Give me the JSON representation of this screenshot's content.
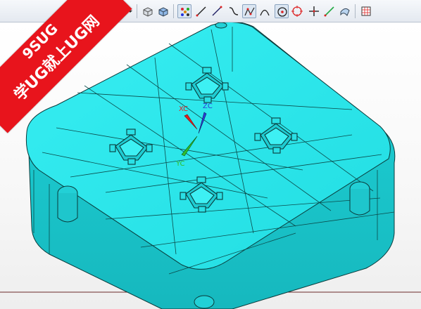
{
  "toolbar": {
    "buttons": [
      {
        "name": "rectangle-select-icon"
      },
      {
        "name": "select-dropdown-icon"
      },
      {
        "name": "shaded-body-icon"
      },
      {
        "name": "solid-block-icon"
      },
      {
        "name": "snap-points-icon"
      },
      {
        "name": "line-curve-icon"
      },
      {
        "name": "arc-curve-icon"
      },
      {
        "name": "spline-icon"
      },
      {
        "name": "studio-spline-icon"
      },
      {
        "name": "conic-curve-icon"
      },
      {
        "name": "arc-center-icon"
      },
      {
        "name": "circle-icon"
      },
      {
        "name": "point-icon"
      },
      {
        "name": "offset-curve-icon"
      },
      {
        "name": "project-curve-icon"
      },
      {
        "name": "layer-grid-icon"
      }
    ]
  },
  "watermark": {
    "line1": "9SUG",
    "line2": "学UG就上UG网",
    "color": "#e8141c"
  },
  "axes": {
    "xc": "XC",
    "yc": "YC",
    "zc": "ZC",
    "xc_color": "#e02020",
    "yc_color": "#2fbf2f",
    "zc_color": "#2a3fd8"
  },
  "model": {
    "body_color": "#2de3e8",
    "edge_color": "#0a3a3a"
  }
}
